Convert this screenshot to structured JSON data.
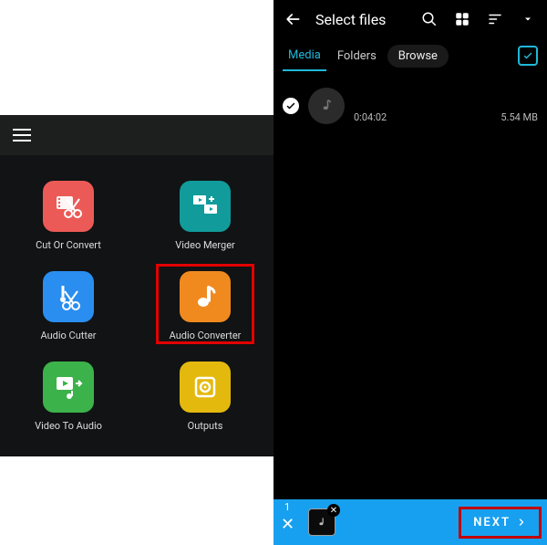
{
  "left": {
    "tools": [
      {
        "label": "Cut Or Convert"
      },
      {
        "label": "Video Merger"
      },
      {
        "label": "Audio Cutter"
      },
      {
        "label": "Audio Converter"
      },
      {
        "label": "Video To Audio"
      },
      {
        "label": "Outputs"
      }
    ]
  },
  "right": {
    "title": "Select files",
    "tabs": {
      "media": "Media",
      "folders": "Folders",
      "browse": "Browse"
    },
    "item": {
      "duration": "0:04:02",
      "size": "5.54 MB"
    },
    "bottom": {
      "count": "1",
      "next": "NEXT"
    }
  }
}
